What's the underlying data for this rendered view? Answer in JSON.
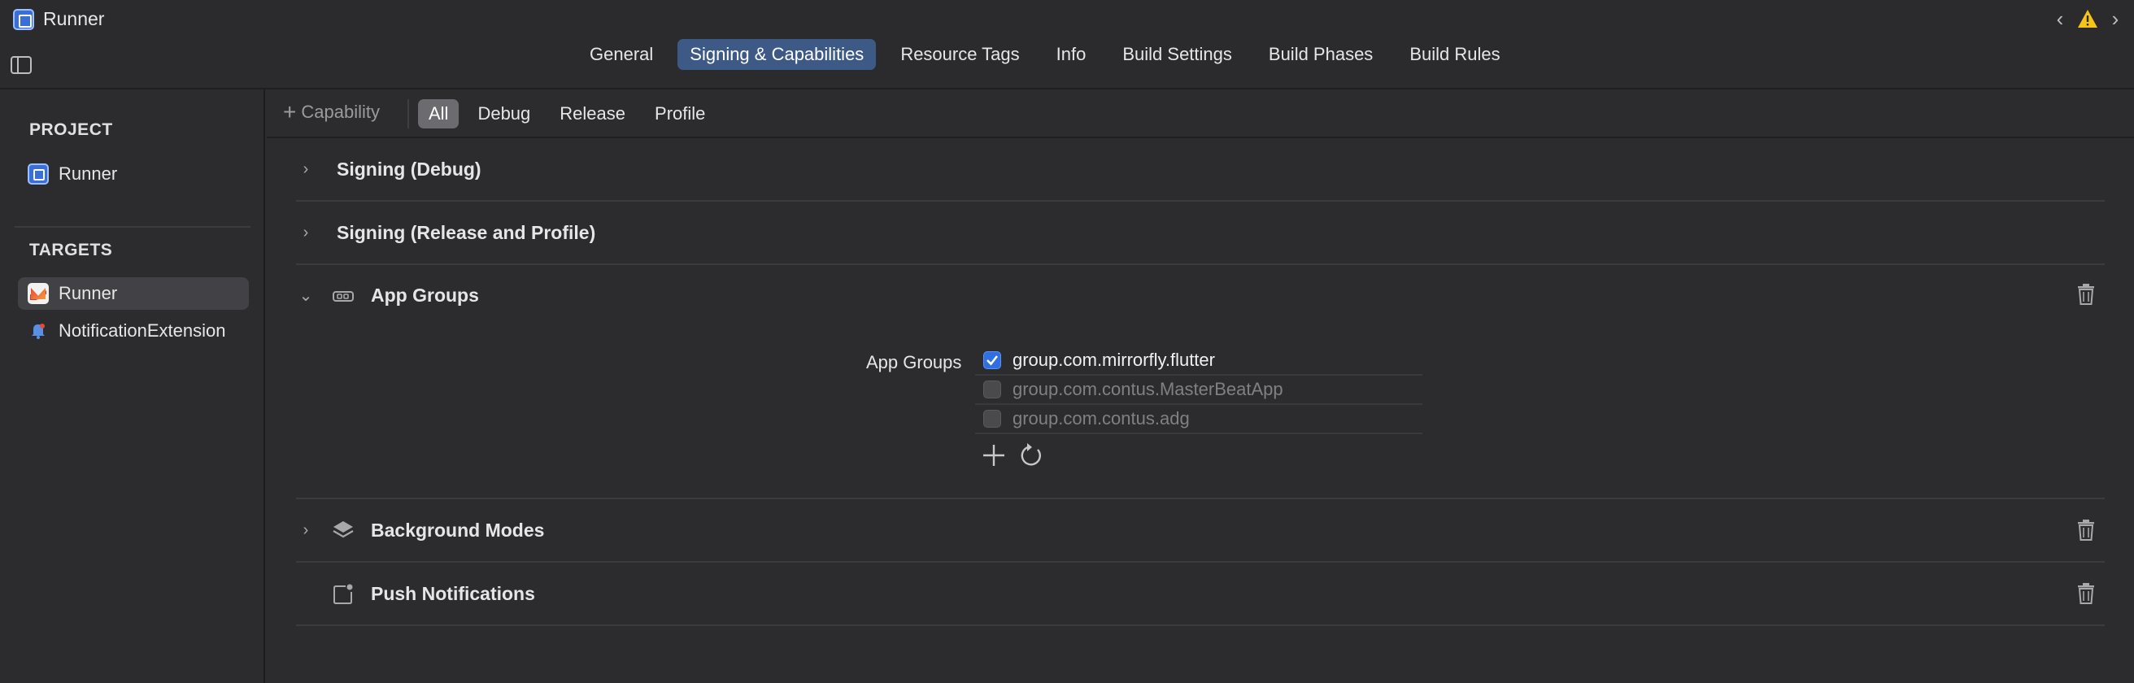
{
  "window": {
    "title": "Runner"
  },
  "tabs": [
    {
      "label": "General",
      "active": false
    },
    {
      "label": "Signing & Capabilities",
      "active": true
    },
    {
      "label": "Resource Tags",
      "active": false
    },
    {
      "label": "Info",
      "active": false
    },
    {
      "label": "Build Settings",
      "active": false
    },
    {
      "label": "Build Phases",
      "active": false
    },
    {
      "label": "Build Rules",
      "active": false
    }
  ],
  "sidebar": {
    "project_header": "PROJECT",
    "project_item": "Runner",
    "targets_header": "TARGETS",
    "targets": [
      {
        "label": "Runner",
        "selected": true
      },
      {
        "label": "NotificationExtension",
        "selected": false
      }
    ]
  },
  "filterbar": {
    "capability_label": "Capability",
    "filters": [
      {
        "label": "All",
        "active": true
      },
      {
        "label": "Debug",
        "active": false
      },
      {
        "label": "Release",
        "active": false
      },
      {
        "label": "Profile",
        "active": false
      }
    ]
  },
  "capabilities": {
    "signing_debug": "Signing (Debug)",
    "signing_release": "Signing (Release and Profile)",
    "app_groups": "App Groups",
    "background_modes": "Background Modes",
    "push_notifications": "Push Notifications"
  },
  "app_groups": {
    "field_label": "App Groups",
    "items": [
      {
        "name": "group.com.mirrorfly.flutter",
        "checked": true
      },
      {
        "name": "group.com.contus.MasterBeatApp",
        "checked": false
      },
      {
        "name": "group.com.contus.adg",
        "checked": false
      }
    ]
  },
  "colors": {
    "accent": "#3d5a86",
    "checkbox": "#2f6fe0",
    "warning": "#f5c518"
  }
}
